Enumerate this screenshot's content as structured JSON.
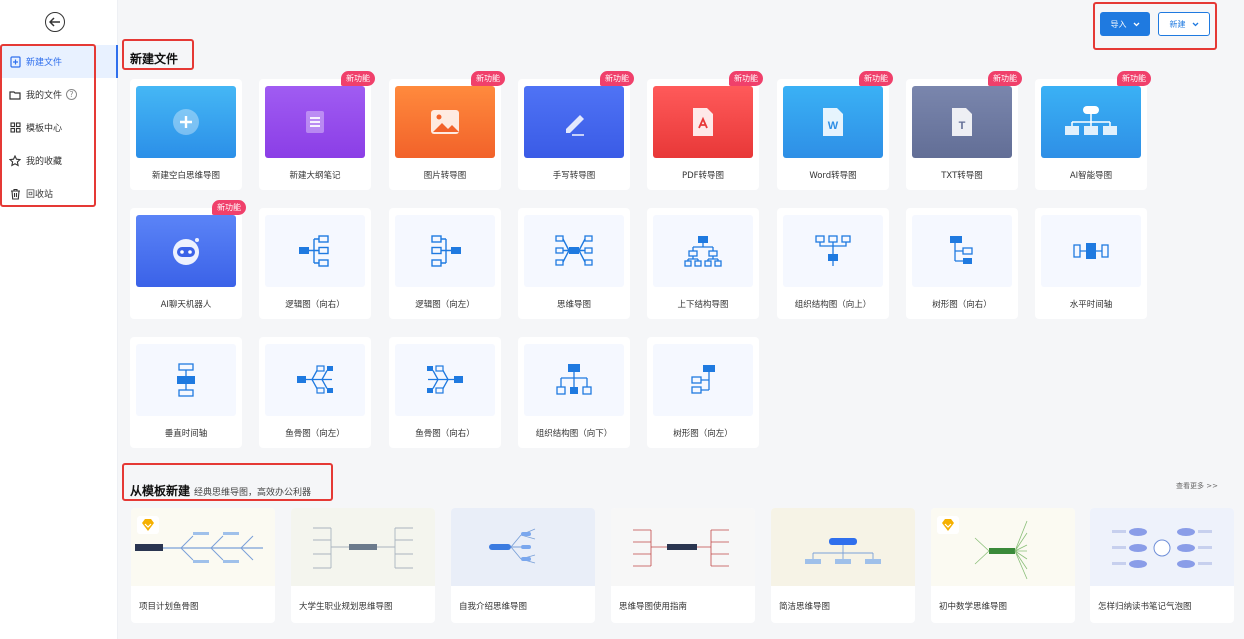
{
  "sidebar": {
    "items": [
      {
        "label": "新建文件"
      },
      {
        "label": "我的文件"
      },
      {
        "label": "模板中心"
      },
      {
        "label": "我的收藏"
      },
      {
        "label": "回收站"
      }
    ]
  },
  "header": {
    "import_label": "导入",
    "new_label": "新建"
  },
  "new_file": {
    "title": "新建文件",
    "badge": "新功能",
    "cards": [
      {
        "label": "新建空白思维导图"
      },
      {
        "label": "新建大纲笔记"
      },
      {
        "label": "图片转导图"
      },
      {
        "label": "手写转导图"
      },
      {
        "label": "PDF转导图"
      },
      {
        "label": "Word转导图"
      },
      {
        "label": "TXT转导图"
      },
      {
        "label": "AI智能导图"
      },
      {
        "label": "AI聊天机器人"
      },
      {
        "label": "逻辑图（向右）"
      },
      {
        "label": "逻辑图（向左）"
      },
      {
        "label": "思维导图"
      },
      {
        "label": "上下结构导图"
      },
      {
        "label": "组织结构图（向上）"
      },
      {
        "label": "树形图（向右）"
      },
      {
        "label": "水平时间轴"
      },
      {
        "label": "垂直时间轴"
      },
      {
        "label": "鱼骨图（向左）"
      },
      {
        "label": "鱼骨图（向右）"
      },
      {
        "label": "组织结构图（向下）"
      },
      {
        "label": "树形图（向左）"
      }
    ]
  },
  "templates": {
    "title": "从模板新建",
    "subtitle": "经典思维导图，高效办公利器",
    "see_more": "查看更多 >>",
    "items": [
      {
        "label": "项目计划鱼骨图"
      },
      {
        "label": "大学生职业规划思维导图"
      },
      {
        "label": "自我介绍思维导图"
      },
      {
        "label": "思维导图使用指南"
      },
      {
        "label": "简洁思维导图"
      },
      {
        "label": "初中数学思维导图"
      },
      {
        "label": "怎样归纳读书笔记气泡图"
      }
    ]
  },
  "colors": {
    "accent": "#1f7ae0",
    "badge": "#f0406b",
    "highlight": "#e53935"
  }
}
